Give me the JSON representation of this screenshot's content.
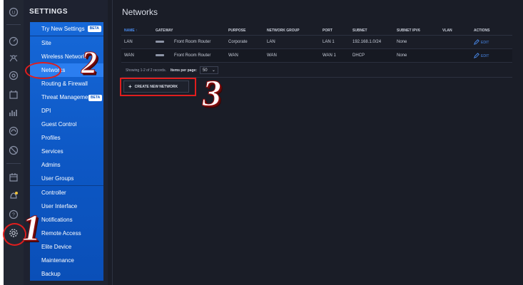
{
  "sidebar": {
    "title": "SETTINGS",
    "beta_label": "BETA",
    "items": [
      {
        "label": "Try New Settings",
        "badge": "BETA"
      },
      {
        "label": "Site"
      },
      {
        "label": "Wireless Networks"
      },
      {
        "label": "Networks",
        "active": true
      },
      {
        "label": "Routing & Firewall"
      },
      {
        "label": "Threat Management",
        "badge": "BETA"
      },
      {
        "label": "DPI"
      },
      {
        "label": "Guest Control"
      },
      {
        "label": "Profiles"
      },
      {
        "label": "Services"
      },
      {
        "label": "Admins"
      },
      {
        "label": "User Groups"
      },
      {
        "label": "Controller"
      },
      {
        "label": "User Interface"
      },
      {
        "label": "Notifications"
      },
      {
        "label": "Remote Access"
      },
      {
        "label": "Elite Device"
      },
      {
        "label": "Maintenance"
      },
      {
        "label": "Backup"
      }
    ]
  },
  "iconbar": {
    "icons": [
      "unifi-logo-icon",
      "dashboard-icon",
      "map-icon",
      "devices-icon",
      "statistics-icon",
      "insights-icon",
      "security-icon",
      "events-icon",
      "alerts-icon",
      "help-icon",
      "settings-gear-icon"
    ]
  },
  "main": {
    "title": "Networks",
    "columns": [
      "NAME",
      "GATEWAY",
      "PURPOSE",
      "NETWORK GROUP",
      "PORT",
      "SUBNET",
      "SUBNET IPV6",
      "VLAN",
      "ACTIONS"
    ],
    "sort_indicator": "↑",
    "rows": [
      {
        "name": "LAN",
        "gateway": "Front Room Router",
        "purpose": "Corporate",
        "network_group": "LAN",
        "port": "LAN 1",
        "subnet": "192.168.1.0/24",
        "subnet_ipv6": "None",
        "vlan": "",
        "action": "EDIT"
      },
      {
        "name": "WAN",
        "gateway": "Front Room Router",
        "purpose": "WAN",
        "network_group": "WAN",
        "port": "WAN 1",
        "subnet": "DHCP",
        "subnet_ipv6": "None",
        "vlan": "",
        "action": "EDIT"
      }
    ],
    "pager": {
      "records_text": "Showing 1-2 of 2 records.",
      "items_per_page_label": "Items per page:",
      "items_per_page_value": "50"
    },
    "create_button": "CREATE NEW NETWORK"
  },
  "annotations": {
    "step1": "1",
    "step2": "2",
    "step3": "3",
    "highlight_color": "#e01e1e"
  },
  "colors": {
    "accent": "#1668d8",
    "link": "#4a8cf0",
    "background": "#1a1d27"
  }
}
